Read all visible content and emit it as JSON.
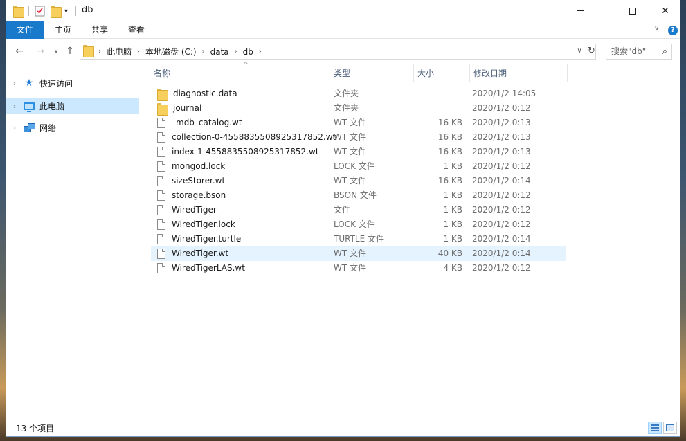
{
  "window": {
    "title": "db"
  },
  "titlebar": {
    "dropdown_glyph": "▾",
    "minimize_icon": "minimize-icon",
    "maximize_icon": "maximize-icon",
    "close_glyph": "✕"
  },
  "ribbon": {
    "tabs": [
      {
        "label": "文件",
        "active": true
      },
      {
        "label": "主页"
      },
      {
        "label": "共享"
      },
      {
        "label": "查看"
      }
    ],
    "collapse_glyph": "∨",
    "help_glyph": "?"
  },
  "navigation": {
    "back_glyph": "←",
    "forward_glyph": "→",
    "recent_glyph": "∨",
    "up_glyph": "↑",
    "breadcrumb": [
      "此电脑",
      "本地磁盘 (C:)",
      "data",
      "db"
    ],
    "separator_glyph": "›",
    "dropdown_glyph": "∨",
    "refresh_glyph": "↻",
    "search_placeholder": "搜索\"db\"",
    "search_icon_glyph": "⌕"
  },
  "sidebar": {
    "items": [
      {
        "label": "快速访问",
        "icon": "star-icon",
        "selected": false
      },
      {
        "label": "此电脑",
        "icon": "this-pc-icon",
        "selected": true
      },
      {
        "label": "网络",
        "icon": "network-icon",
        "selected": false
      }
    ],
    "expand_glyph": "›"
  },
  "filelist": {
    "columns": {
      "name": "名称",
      "type": "类型",
      "size": "大小",
      "date": "修改日期"
    },
    "sort_glyph": "^",
    "rows": [
      {
        "name": "diagnostic.data",
        "type": "文件夹",
        "size": "",
        "date": "2020/1/2 14:05",
        "kind": "folder"
      },
      {
        "name": "journal",
        "type": "文件夹",
        "size": "",
        "date": "2020/1/2 0:12",
        "kind": "folder"
      },
      {
        "name": "_mdb_catalog.wt",
        "type": "WT 文件",
        "size": "16 KB",
        "date": "2020/1/2 0:13",
        "kind": "file"
      },
      {
        "name": "collection-0-4558835508925317852.wt",
        "type": "WT 文件",
        "size": "16 KB",
        "date": "2020/1/2 0:13",
        "kind": "file"
      },
      {
        "name": "index-1-4558835508925317852.wt",
        "type": "WT 文件",
        "size": "16 KB",
        "date": "2020/1/2 0:13",
        "kind": "file"
      },
      {
        "name": "mongod.lock",
        "type": "LOCK 文件",
        "size": "1 KB",
        "date": "2020/1/2 0:12",
        "kind": "file"
      },
      {
        "name": "sizeStorer.wt",
        "type": "WT 文件",
        "size": "16 KB",
        "date": "2020/1/2 0:14",
        "kind": "file"
      },
      {
        "name": "storage.bson",
        "type": "BSON 文件",
        "size": "1 KB",
        "date": "2020/1/2 0:12",
        "kind": "file"
      },
      {
        "name": "WiredTiger",
        "type": "文件",
        "size": "1 KB",
        "date": "2020/1/2 0:12",
        "kind": "file"
      },
      {
        "name": "WiredTiger.lock",
        "type": "LOCK 文件",
        "size": "1 KB",
        "date": "2020/1/2 0:12",
        "kind": "file"
      },
      {
        "name": "WiredTiger.turtle",
        "type": "TURTLE 文件",
        "size": "1 KB",
        "date": "2020/1/2 0:14",
        "kind": "file"
      },
      {
        "name": "WiredTiger.wt",
        "type": "WT 文件",
        "size": "40 KB",
        "date": "2020/1/2 0:14",
        "kind": "file",
        "selected": true
      },
      {
        "name": "WiredTigerLAS.wt",
        "type": "WT 文件",
        "size": "4 KB",
        "date": "2020/1/2 0:12",
        "kind": "file"
      }
    ]
  },
  "status": {
    "count": "13 个项目"
  },
  "colors": {
    "accent": "#1979ca",
    "selection": "#cce8ff",
    "hover": "#e5f3ff"
  }
}
